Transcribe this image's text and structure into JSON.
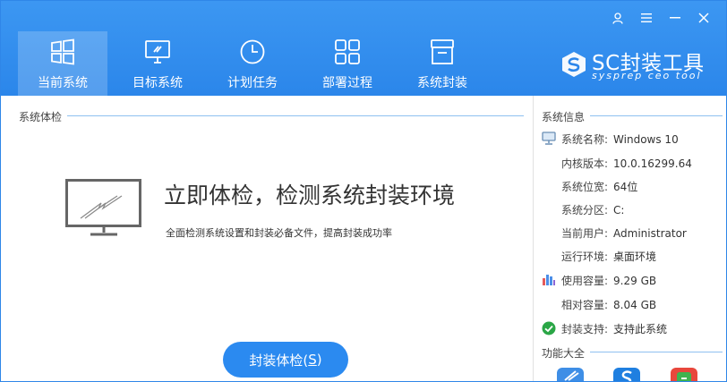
{
  "window": {
    "user_icon": "user-icon",
    "menu_icon": "menu-icon",
    "minimize_icon": "minimize-icon",
    "close_icon": "close-icon"
  },
  "tabs": [
    {
      "label": "当前系统",
      "icon": "windows-icon",
      "active": true
    },
    {
      "label": "目标系统",
      "icon": "monitor-icon",
      "active": false
    },
    {
      "label": "计划任务",
      "icon": "clock-icon",
      "active": false
    },
    {
      "label": "部署过程",
      "icon": "grid-icon",
      "active": false
    },
    {
      "label": "系统封装",
      "icon": "package-icon",
      "active": false
    }
  ],
  "logo": {
    "title": "SC封装工具",
    "subtitle": "sysprep ceo tool"
  },
  "left": {
    "section_title": "系统体检",
    "heading": "立即体检，检测系统封装环境",
    "description": "全面检测系统设置和封装必备文件，提高封装成功率",
    "button_label": "封装体检(",
    "button_hotkey": "S",
    "button_suffix": ")"
  },
  "info": {
    "section_title": "系统信息",
    "rows": [
      {
        "key": "系统名称:",
        "value": "Windows 10"
      },
      {
        "key": "内核版本:",
        "value": "10.0.16299.64"
      },
      {
        "key": "系统位宽:",
        "value": "64位"
      },
      {
        "key": "系统分区:",
        "value": "C:"
      },
      {
        "key": "当前用户:",
        "value": "Administrator"
      },
      {
        "key": "运行环境:",
        "value": "桌面环境"
      },
      {
        "key": "使用容量:",
        "value": "9.29 GB"
      },
      {
        "key": "相对容量:",
        "value": "8.04 GB"
      },
      {
        "key": "封装支持:",
        "value": "支持此系统"
      }
    ]
  },
  "functions": {
    "section_title": "功能大全"
  },
  "colors": {
    "header": "#2b86ea",
    "accent": "#2b8af0",
    "success": "#2aa646"
  }
}
